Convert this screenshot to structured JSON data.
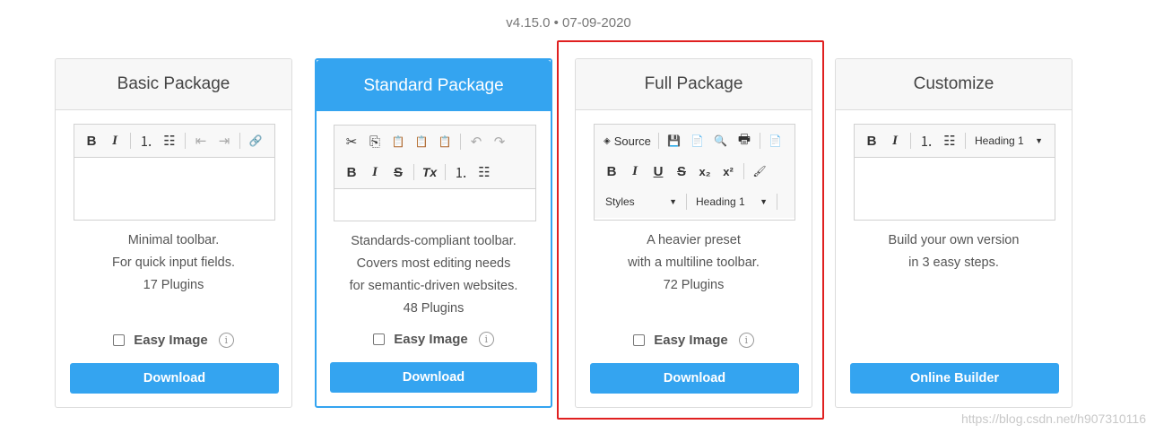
{
  "version": "v4.15.0 • 07-09-2020",
  "cards": [
    {
      "title": "Basic Package",
      "toolbar": {
        "bold": "B",
        "italic": "I",
        "numlist": "⒈",
        "bullist": "☷",
        "outdent": "⇤",
        "indent": "⇥",
        "link": "🔗"
      },
      "desc": [
        "Minimal toolbar.",
        "For quick input fields.",
        "17 Plugins"
      ],
      "easy_image": "Easy Image",
      "button": "Download"
    },
    {
      "title": "Standard Package",
      "toolbar": {
        "cut": "✂",
        "copy": "⎘",
        "paste": "📋",
        "paste_text": "📋",
        "paste_word": "📋",
        "undo": "↶",
        "redo": "↷",
        "bold": "B",
        "italic": "I",
        "strike": "S",
        "remove_format": "Tx",
        "numlist": "⒈",
        "bullist": "☷"
      },
      "desc": [
        "Standards-compliant toolbar.",
        "Covers most editing needs",
        "for semantic-driven websites.",
        "48 Plugins"
      ],
      "easy_image": "Easy Image",
      "button": "Download"
    },
    {
      "title": "Full Package",
      "toolbar": {
        "source": "Source",
        "save": "💾",
        "newpage": "📄",
        "preview": "🔍",
        "print": "🖶",
        "templates": "📄",
        "bold": "B",
        "italic": "I",
        "underline": "U",
        "strike": "S",
        "subscript": "x₂",
        "superscript": "x²",
        "copyformat": "🖌",
        "styles": "Styles",
        "format": "Heading 1"
      },
      "desc": [
        "A heavier preset",
        "with a multiline toolbar.",
        "72 Plugins"
      ],
      "easy_image": "Easy Image",
      "button": "Download"
    },
    {
      "title": "Customize",
      "toolbar": {
        "bold": "B",
        "italic": "I",
        "numlist": "⒈",
        "bullist": "☷",
        "format": "Heading 1"
      },
      "desc": [
        "Build your own version",
        "in 3 easy steps."
      ],
      "button": "Online Builder"
    }
  ],
  "watermark": "https://blog.csdn.net/h907310116",
  "colors": {
    "accent": "#34a4f0",
    "highlight": "#e02020"
  }
}
